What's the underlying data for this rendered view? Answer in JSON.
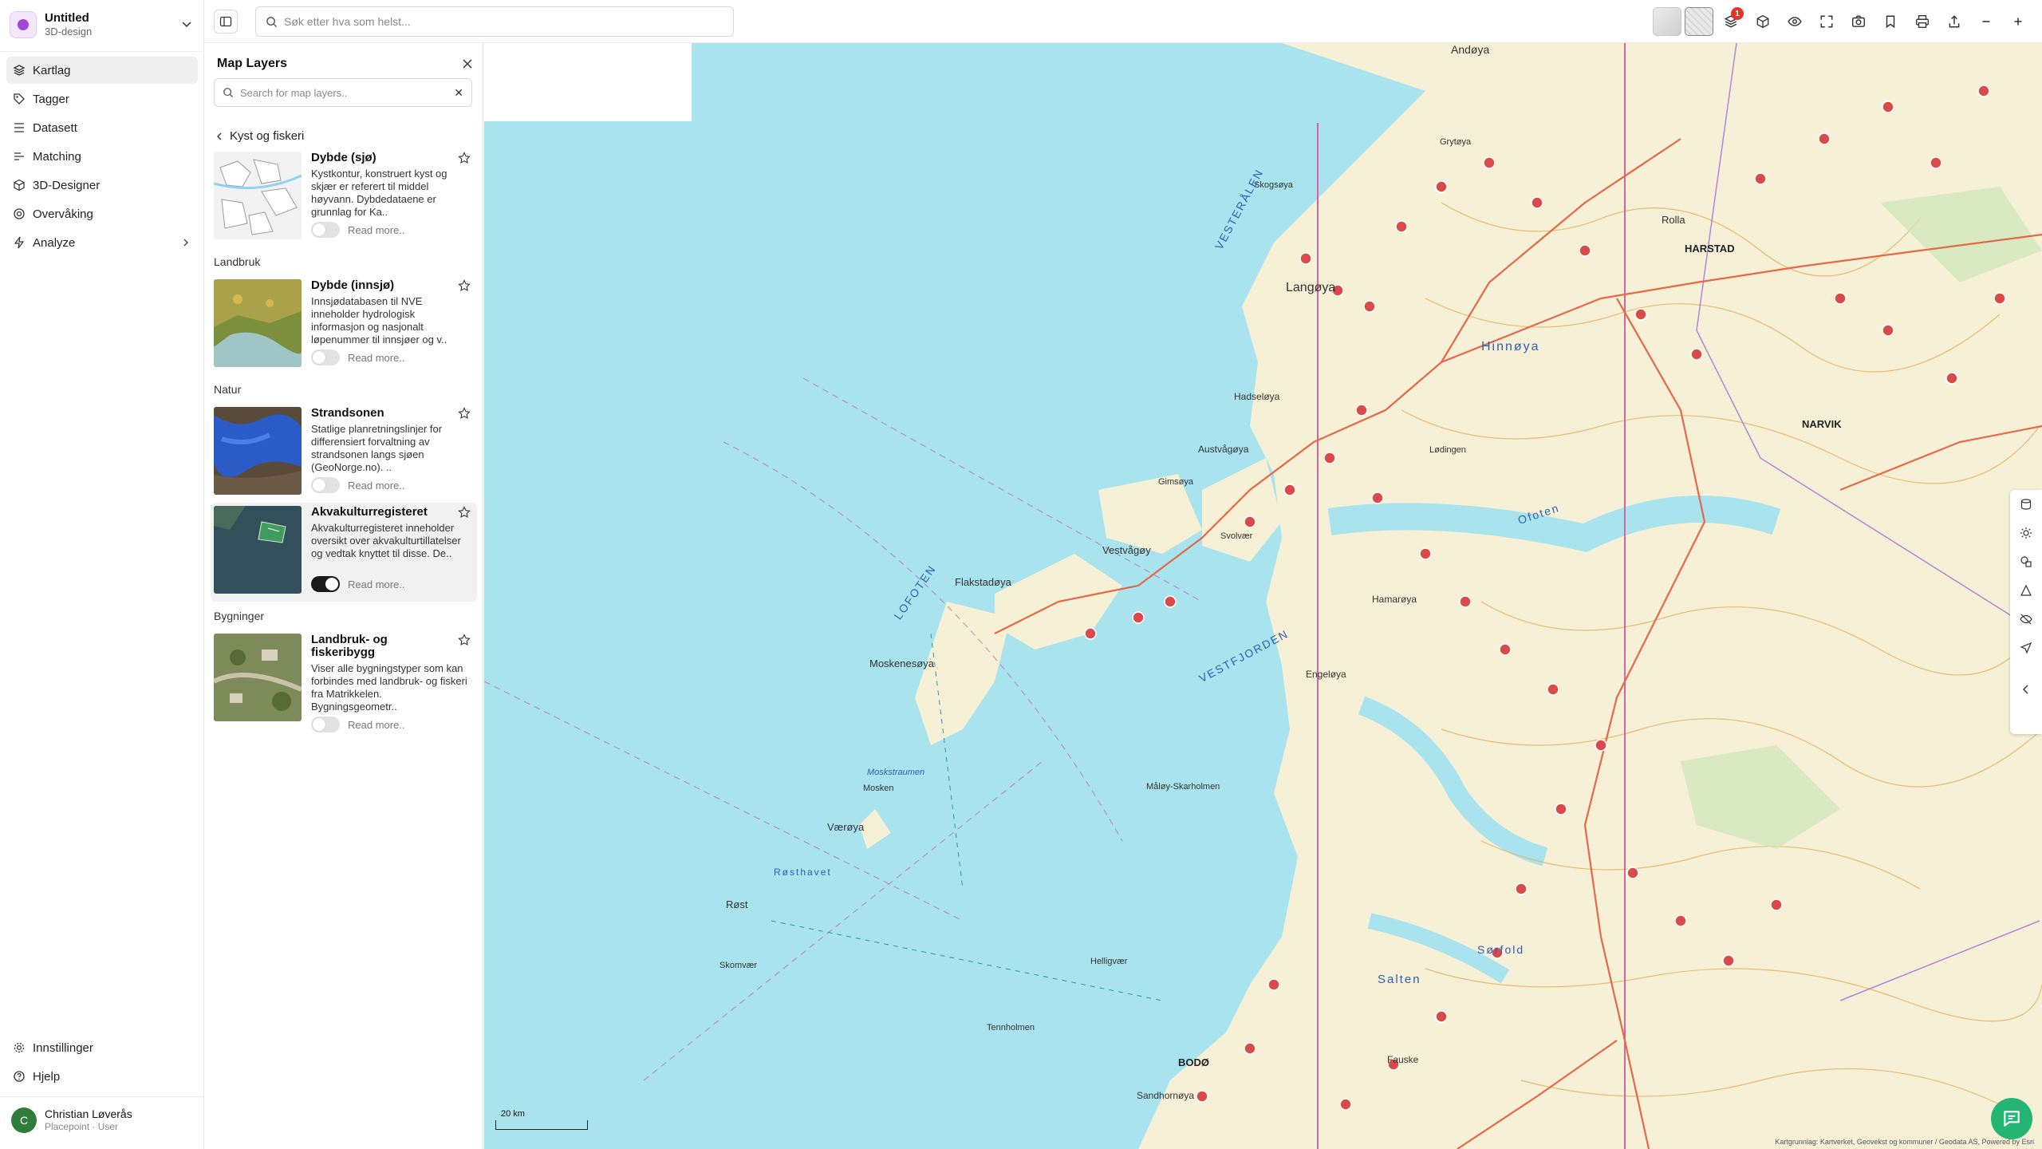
{
  "project": {
    "name": "Untitled",
    "type": "3D-design"
  },
  "nav": {
    "items": [
      {
        "label": "Kartlag",
        "icon": "layers-icon"
      },
      {
        "label": "Tagger",
        "icon": "tag-icon"
      },
      {
        "label": "Datasett",
        "icon": "list-icon"
      },
      {
        "label": "Matching",
        "icon": "matching-icon"
      },
      {
        "label": "3D-Designer",
        "icon": "cube-icon"
      },
      {
        "label": "Overvåking",
        "icon": "radar-icon"
      },
      {
        "label": "Analyze",
        "icon": "bolt-icon"
      }
    ],
    "bottom": [
      {
        "label": "Innstillinger",
        "icon": "gear-icon"
      },
      {
        "label": "Hjelp",
        "icon": "help-icon"
      }
    ],
    "user": {
      "initial": "C",
      "name": "Christian Løverås",
      "role": "Placepoint · User"
    }
  },
  "search": {
    "placeholder": "Søk etter hva som helst..."
  },
  "toolbar": {
    "layers_badge": "1"
  },
  "layers_panel": {
    "title": "Map Layers",
    "search_placeholder": "Search for map layers..",
    "search_clear": "✕",
    "breadcrumb": "Kyst og fiskeri",
    "categories": [
      "Landbruk",
      "Natur",
      "Bygninger"
    ],
    "read_more": "Read more..",
    "layers": [
      {
        "name": "Dybde (sjø)",
        "description": "Kystkontur, konstruert kyst og skjær er referert til middel høyvann. Dybdedataene er grunnlag for Ka..",
        "enabled": false
      },
      {
        "name": "Dybde (innsjø)",
        "description": "Innsjødatabasen til NVE inneholder hydrologisk informasjon og nasjonalt løpenummer til innsjøer og v..",
        "enabled": false
      },
      {
        "name": "Strandsonen",
        "description": "Statlige planretningslinjer for differensiert forvaltning av strandsonen langs sjøen (GeoNorge.no). ..",
        "enabled": false
      },
      {
        "name": "Akvakulturregisteret",
        "description": "Akvakulturregisteret inneholder oversikt over akvakulturtillatelser og vedtak knyttet til disse. De..",
        "enabled": true
      },
      {
        "name": "Landbruk- og fiskeribygg",
        "description": "Viser alle bygningstyper som kan forbindes med landbruk- og fiskeri fra Matrikkelen. Bygningsgeometr..",
        "enabled": false
      }
    ]
  },
  "map": {
    "scale": "20 km",
    "attribution": "Kartgrunnlag: Kartverket, Geovekst og kommuner / Geodata AS, Powered by Esri",
    "labels": {
      "andoya": "Andøya",
      "vesteralen": "VESTERÅLEN",
      "langoya": "Langøya",
      "hinnoya": "Hinnøya",
      "harstad": "HARSTAD",
      "narvik": "NARVIK",
      "lofoten": "LOFOTEN",
      "vestfjorden": "VESTFJORDEN",
      "flakstadoya": "Flakstadøya",
      "vestvagoy": "Vestvågøy",
      "austvagoya": "Austvågøya",
      "moskenesoya": "Moskenesøya",
      "moskstraumen": "Moskstraumen",
      "moskenes": "Mosken",
      "vaeroya": "Værøya",
      "rost": "Røst",
      "rosthavet": "Røsthavet",
      "skomvaer": "Skomvær",
      "hadseloya": "Hadseløya",
      "gimsoya": "Gimsøya",
      "svolvaer": "Svolvær",
      "ofoten": "Ofoten",
      "hamaroya": "Hamarøya",
      "engeloya": "Engeløya",
      "sorfold": "Sørfold",
      "bodo": "BODØ",
      "salten": "Salten",
      "fauske": "Fauske",
      "sandhornoya": "Sandhornøya",
      "tennholmen": "Tennholmen",
      "helligvaer": "Helligvær",
      "maloy": "Måløy-Skarholmen",
      "lodingen": "Lødingen",
      "skogsoya": "Skogsøya",
      "grytoya": "Grytøya",
      "rolla": "Rolla"
    }
  },
  "colors": {
    "sea": "#a9e3ee",
    "land": "#f6f0d6",
    "contour": "#e3b15a",
    "road": "#e4684a",
    "border": "#d2559a",
    "accent": "#a247d6",
    "chat": "#22b573"
  }
}
